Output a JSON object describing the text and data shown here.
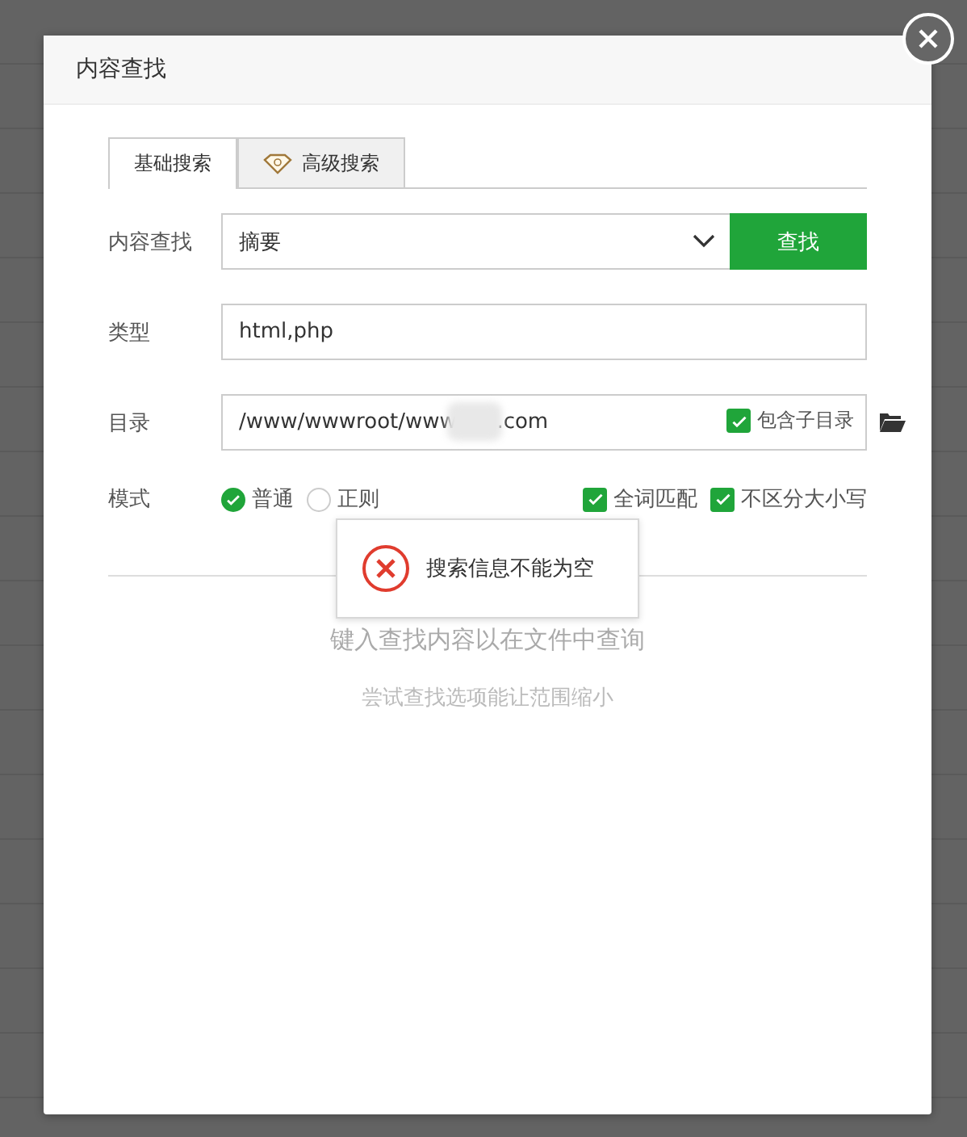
{
  "dialog": {
    "title": "内容查找"
  },
  "tabs": [
    {
      "label": "基础搜索",
      "selected": true,
      "kind": "plain"
    },
    {
      "label": "高级搜索",
      "selected": false,
      "kind": "premium"
    }
  ],
  "form": {
    "content": {
      "label": "内容查找",
      "value": "摘要",
      "button": "查找"
    },
    "type": {
      "label": "类型",
      "value": "html,php"
    },
    "directory": {
      "label": "目录",
      "value": "/www/wwwroot/www      .com",
      "redacted": true,
      "subdirs": {
        "label": "包含子目录",
        "checked": true
      }
    },
    "mode": {
      "label": "模式",
      "radios": [
        {
          "label": "普通",
          "selected": true
        },
        {
          "label": "正则",
          "selected": false
        }
      ],
      "checks": [
        {
          "label": "全词匹配",
          "checked": true
        },
        {
          "label": "不区分大小写",
          "checked": true
        }
      ]
    }
  },
  "empty_state": {
    "title": "键入查找内容以在文件中查询",
    "hint": "尝试查找选项能让范围缩小"
  },
  "toast": {
    "kind": "error",
    "message": "搜索信息不能为空"
  }
}
